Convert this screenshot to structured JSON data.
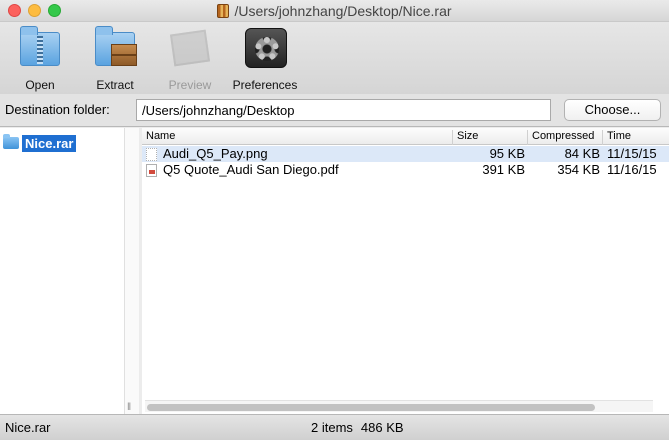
{
  "window": {
    "title": "/Users/johnzhang/Desktop/Nice.rar"
  },
  "toolbar": {
    "open_label": "Open",
    "extract_label": "Extract",
    "preview_label": "Preview",
    "preferences_label": "Preferences"
  },
  "destination": {
    "label": "Destination folder:",
    "value": "/Users/johnzhang/Desktop",
    "choose_label": "Choose..."
  },
  "sidebar": {
    "items": [
      {
        "label": "Nice.rar",
        "icon": "folder-icon"
      }
    ]
  },
  "table": {
    "columns": [
      "Name",
      "Size",
      "Compressed",
      "Time"
    ],
    "rows": [
      {
        "name": "Audi_Q5_Pay.png",
        "size": "95 KB",
        "compressed": "84 KB",
        "time": "11/15/15",
        "icon": "png-file-icon",
        "selected": true
      },
      {
        "name": "Q5 Quote_Audi San Diego.pdf",
        "size": "391 KB",
        "compressed": "354 KB",
        "time": "11/16/15",
        "icon": "pdf-file-icon",
        "selected": false
      }
    ]
  },
  "status": {
    "archive": "Nice.rar",
    "items": "2 items",
    "size": "486 KB"
  },
  "colors": {
    "selection": "#1f6fd1",
    "row_highlight": "#dce8f8"
  }
}
